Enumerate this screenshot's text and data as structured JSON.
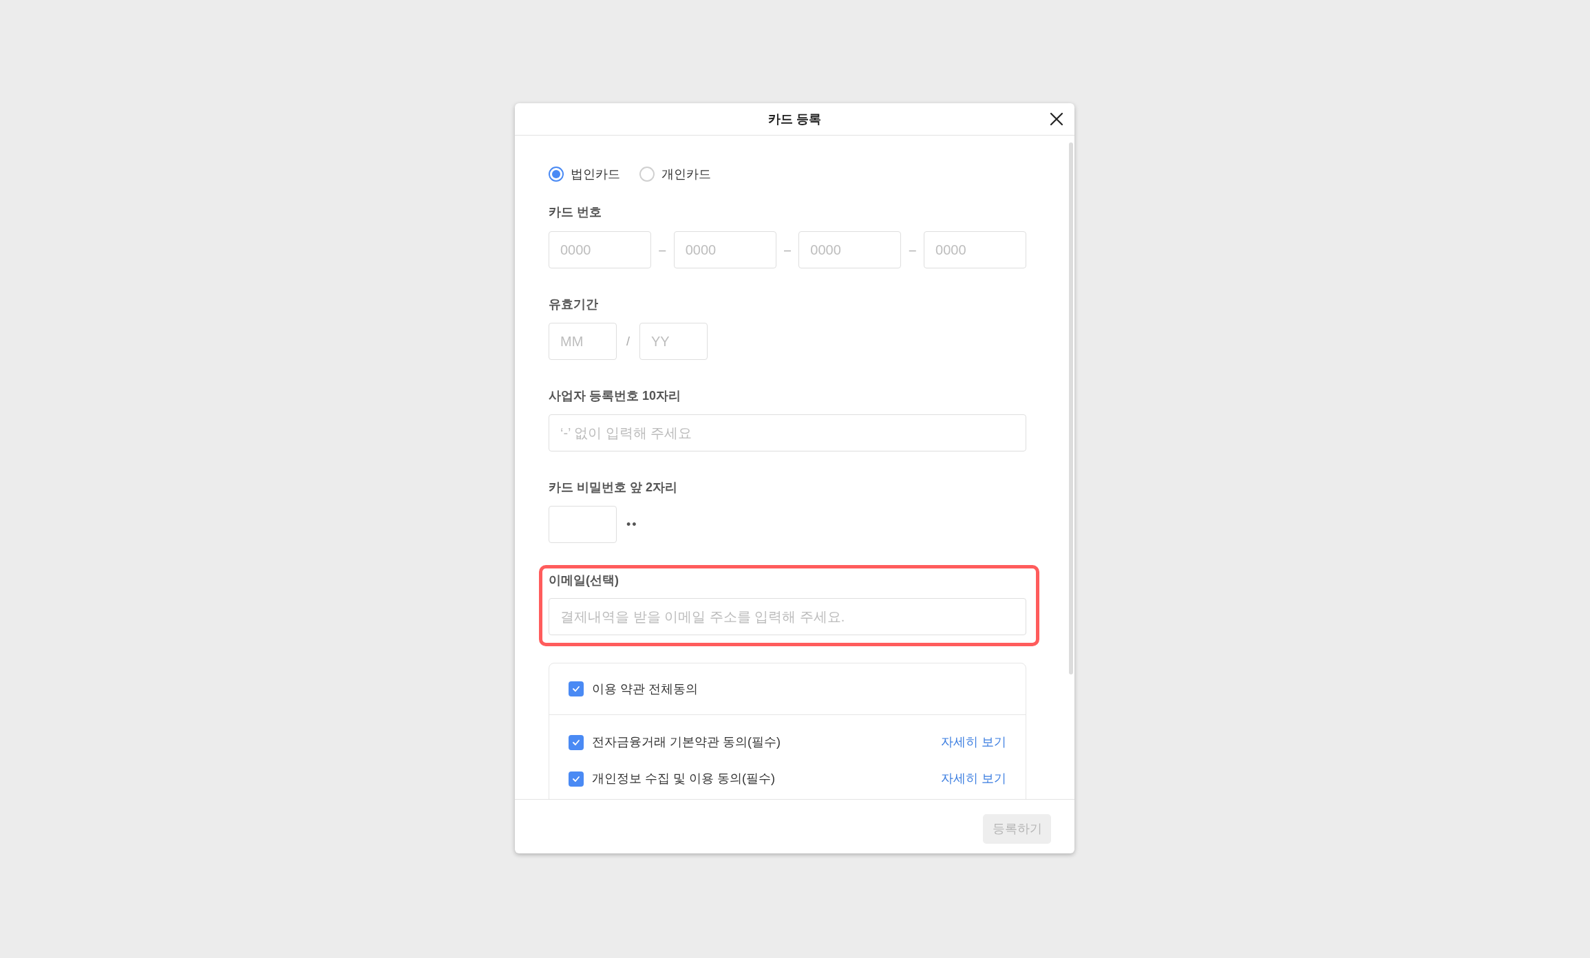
{
  "dialog": {
    "title": "카드 등록"
  },
  "card_type": [
    {
      "label": "법인카드",
      "selected": true
    },
    {
      "label": "개인카드",
      "selected": false
    }
  ],
  "card_number": {
    "label": "카드 번호",
    "fields": [
      {
        "placeholder": "0000"
      },
      {
        "placeholder": "0000"
      },
      {
        "placeholder": "0000"
      },
      {
        "placeholder": "0000"
      }
    ],
    "separators": [
      "–",
      "–",
      "–"
    ]
  },
  "expiry": {
    "label": "유효기간",
    "fields": [
      {
        "placeholder": "MM"
      },
      {
        "placeholder": "YY"
      }
    ],
    "separators": [
      "/"
    ]
  },
  "business_number": {
    "label": "사업자 등록번호 10자리",
    "placeholder": "‘-’ 없이 입력해 주세요"
  },
  "card_password": {
    "label": "카드 비밀번호 앞 2자리",
    "mask": "••"
  },
  "email": {
    "label": "이메일(선택)",
    "placeholder": "결제내역을 받을 이메일 주소를 입력해 주세요.",
    "highlighted": true
  },
  "terms": {
    "all": {
      "label": "이용 약관 전체동의",
      "checked": true
    },
    "items": [
      {
        "label": "전자금융거래 기본약관 동의(필수)",
        "checked": true,
        "link": "자세히 보기"
      },
      {
        "label": "개인정보 수집 및 이용 동의(필수)",
        "checked": true,
        "link": "자세히 보기"
      }
    ]
  },
  "footer": {
    "submit": {
      "label": "등록하기",
      "disabled": true
    }
  }
}
